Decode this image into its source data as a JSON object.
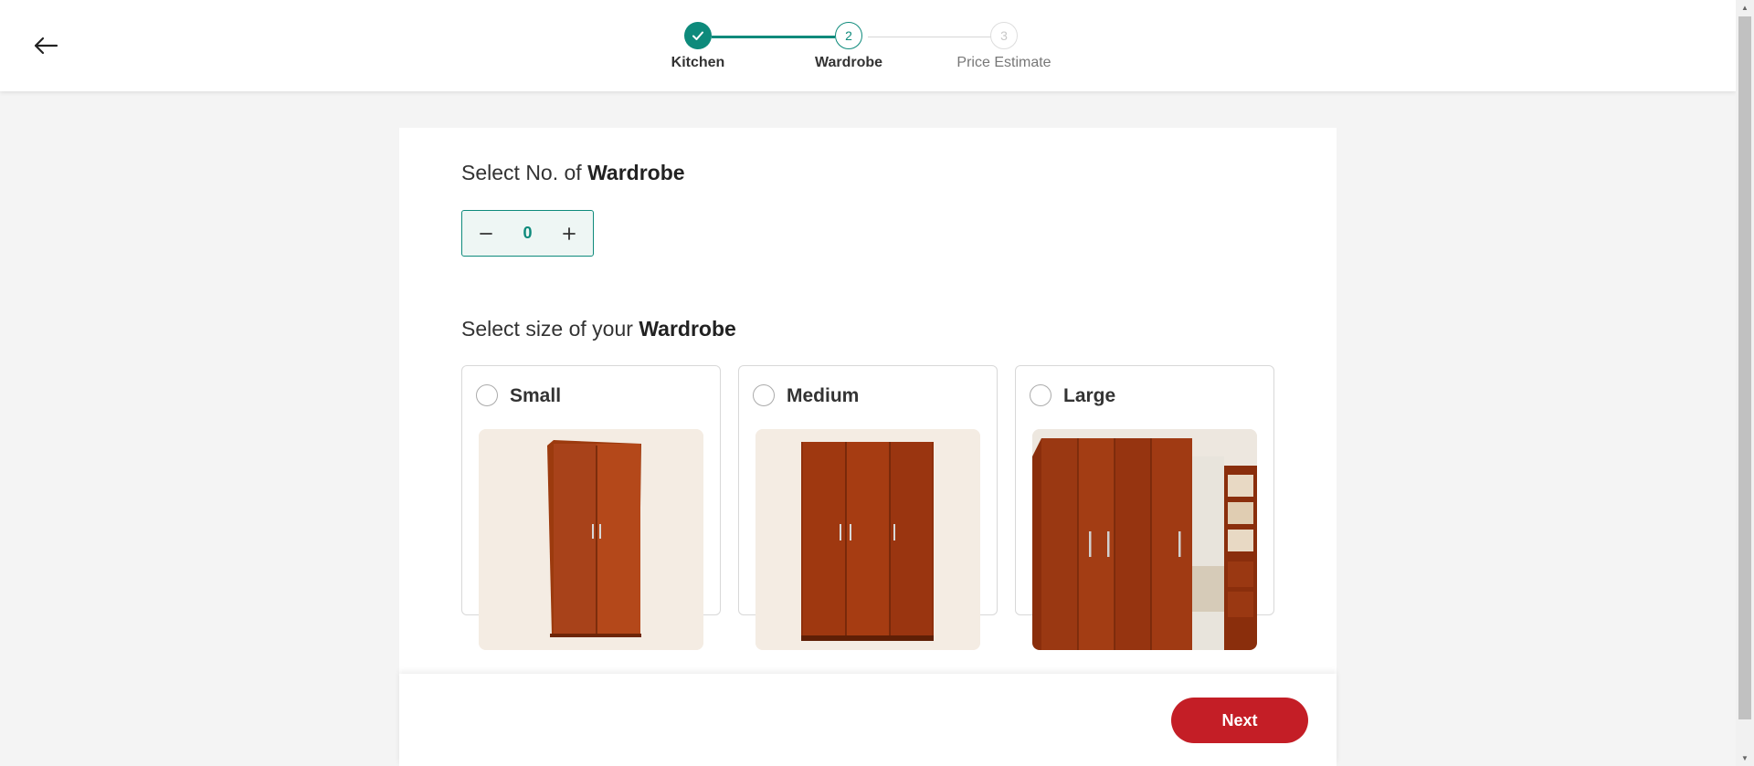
{
  "header": {
    "steps": [
      {
        "number": "1",
        "label": "Kitchen",
        "status": "completed"
      },
      {
        "number": "2",
        "label": "Wardrobe",
        "status": "active"
      },
      {
        "number": "3",
        "label": "Price Estimate",
        "status": "pending"
      }
    ]
  },
  "count_section": {
    "title_prefix": "Select No. of ",
    "title_bold": "Wardrobe",
    "value": "0"
  },
  "size_section": {
    "title_prefix": "Select size of your ",
    "title_bold": "Wardrobe",
    "options": [
      {
        "label": "Small",
        "selected": false
      },
      {
        "label": "Medium",
        "selected": false
      },
      {
        "label": "Large",
        "selected": false
      }
    ]
  },
  "footer": {
    "next_label": "Next"
  },
  "colors": {
    "accent": "#0d8a7b",
    "primary_button": "#c41e26",
    "background": "#f4f4f4"
  }
}
